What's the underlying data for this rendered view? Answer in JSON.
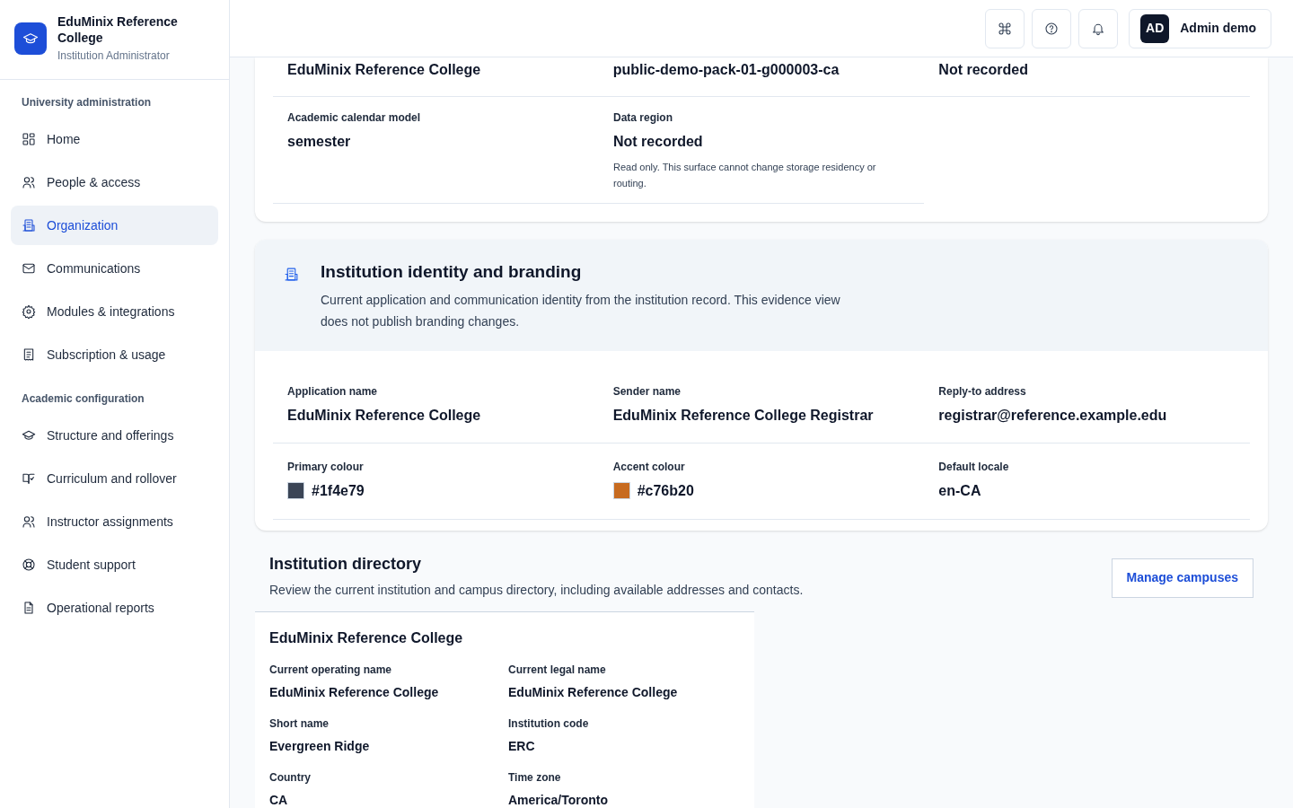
{
  "sidebar": {
    "brand": {
      "name": "EduMinix Reference College",
      "role": "Institution Administrator"
    },
    "sections": [
      {
        "title": "University administration",
        "items": [
          {
            "label": "Home",
            "selected": false
          },
          {
            "label": "People & access",
            "selected": false
          },
          {
            "label": "Organization",
            "selected": true
          },
          {
            "label": "Communications",
            "selected": false
          },
          {
            "label": "Modules & integrations",
            "selected": false
          },
          {
            "label": "Subscription & usage",
            "selected": false
          }
        ]
      },
      {
        "title": "Academic configuration",
        "items": [
          {
            "label": "Structure and offerings",
            "selected": false
          },
          {
            "label": "Curriculum and rollover",
            "selected": false
          },
          {
            "label": "Instructor assignments",
            "selected": false
          },
          {
            "label": "Student support",
            "selected": false
          },
          {
            "label": "Operational reports",
            "selected": false
          }
        ]
      }
    ]
  },
  "header": {
    "user": {
      "initials": "AD",
      "name": "Admin demo"
    }
  },
  "summary_card": {
    "rows": [
      [
        {
          "value": "EduMinix Reference College"
        },
        {
          "value": "public-demo-pack-01-g000003-ca"
        },
        {
          "value": "Not recorded"
        }
      ],
      [
        {
          "label": "Academic calendar model",
          "value": "semester"
        },
        {
          "label": "Data region",
          "value": "Not recorded",
          "note": "Read only. This surface cannot change storage residency or routing."
        }
      ]
    ]
  },
  "branding": {
    "title": "Institution identity and branding",
    "description": "Current application and communication identity from the institution record. This evidence view does not publish branding changes.",
    "rows": [
      [
        {
          "label": "Application name",
          "value": "EduMinix Reference College"
        },
        {
          "label": "Sender name",
          "value": "EduMinix Reference College Registrar"
        },
        {
          "label": "Reply-to address",
          "value": "registrar@reference.example.edu"
        }
      ],
      [
        {
          "label": "Primary colour",
          "value": "#1f4e79",
          "color": "#3b4556"
        },
        {
          "label": "Accent colour",
          "value": "#c76b20",
          "color": "#c76b20"
        },
        {
          "label": "Default locale",
          "value": "en-CA"
        }
      ]
    ]
  },
  "directory": {
    "title": "Institution directory",
    "description": "Review the current institution and campus directory, including available addresses and contacts.",
    "button": "Manage campuses",
    "card": {
      "title": "EduMinix Reference College",
      "fields": [
        {
          "label": "Current operating name",
          "value": "EduMinix Reference College"
        },
        {
          "label": "Current legal name",
          "value": "EduMinix Reference College"
        },
        {
          "label": "Short name",
          "value": "Evergreen Ridge"
        },
        {
          "label": "Institution code",
          "value": "ERC"
        },
        {
          "label": "Country",
          "value": "CA"
        },
        {
          "label": "Time zone",
          "value": "America/Toronto"
        }
      ]
    }
  }
}
